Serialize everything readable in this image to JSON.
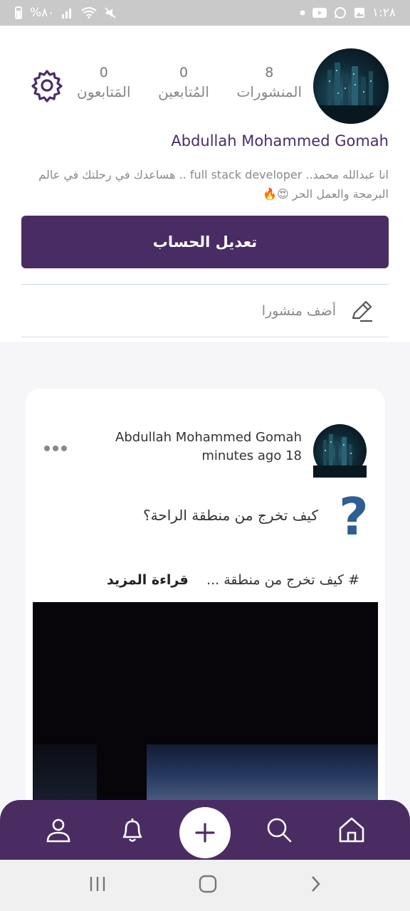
{
  "status_bar": {
    "time": "١:٢٨",
    "battery": "%٨٠"
  },
  "profile": {
    "name": "Abdullah Mohammed Gomah",
    "bio": "انا عبدالله محمد.. full stack developer .. هساعدك في رحلتك في عالم البرمجة والعمل الحر 😍🔥",
    "stats": [
      {
        "count": "8",
        "label": "المنشورات"
      },
      {
        "count": "0",
        "label": "المُتابعين"
      },
      {
        "count": "0",
        "label": "المَتابعون"
      }
    ],
    "edit_button_label": "تعديل الحساب",
    "add_post_label": "أضف منشورا"
  },
  "post": {
    "author": "Abdullah Mohammed Gomah",
    "time": "minutes ago 18",
    "question_mark": "?",
    "title": "كيف تخرج من منطقة الراحة؟",
    "excerpt": "# كيف تخرج من منطقة ...",
    "read_more": "قراءة المزيد"
  },
  "nav": {
    "items": [
      "profile-icon",
      "bell-icon",
      "add-icon",
      "search-icon",
      "home-icon"
    ]
  },
  "colors": {
    "primary": "#482c63",
    "question": "#2f5e93"
  }
}
